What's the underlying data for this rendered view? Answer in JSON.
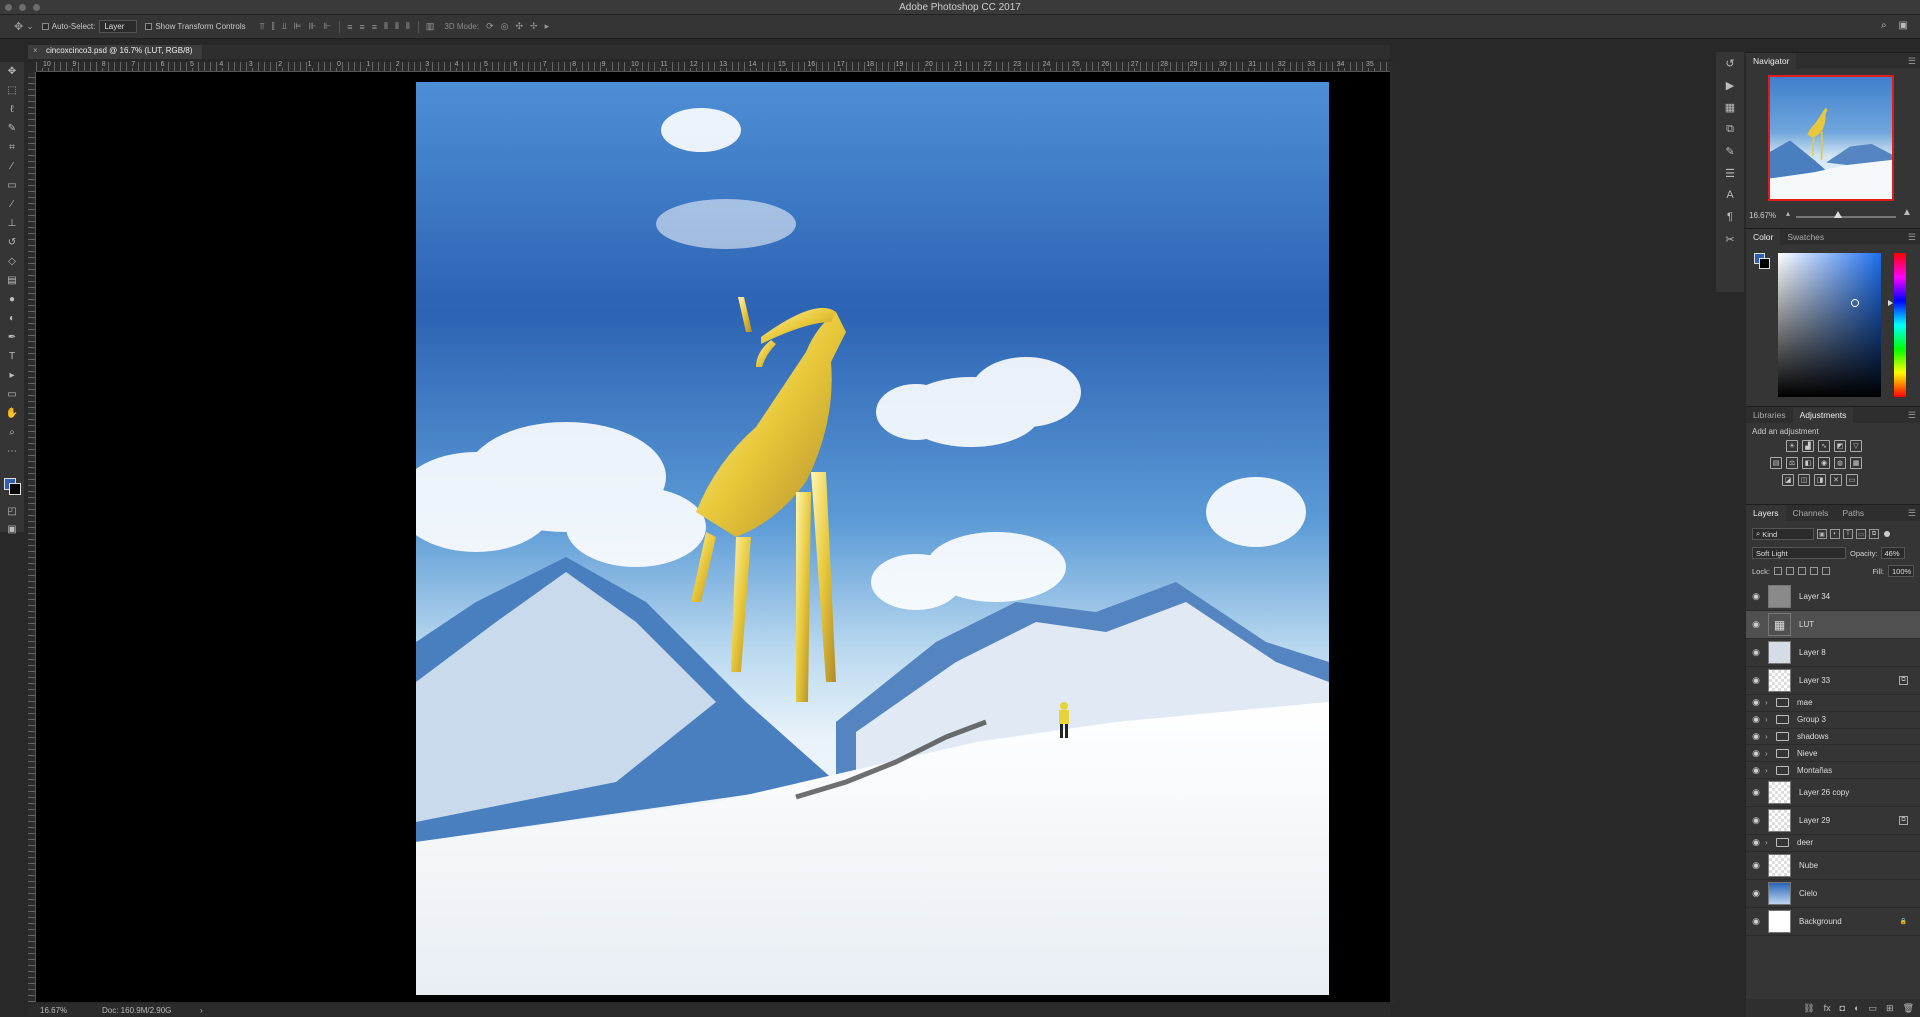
{
  "window": {
    "title": "Adobe Photoshop CC 2017"
  },
  "options_bar": {
    "auto_select_label": "Auto-Select:",
    "auto_select_value": "Layer",
    "transform_label": "Show Transform Controls",
    "mode_3d_label": "3D Mode:"
  },
  "document": {
    "tab_title": "cincoxcinco3.psd @ 16.7% (LUT, RGB/8)",
    "zoom": "16.67%",
    "doc_size": "Doc: 160.9M/2.90G"
  },
  "ruler_numbers": [
    "10",
    "9",
    "8",
    "7",
    "6",
    "5",
    "4",
    "3",
    "2",
    "1",
    "0",
    "1",
    "2",
    "3",
    "4",
    "5",
    "6",
    "7",
    "8",
    "9",
    "10",
    "11",
    "12",
    "13",
    "14",
    "15",
    "16",
    "17",
    "18",
    "19",
    "20",
    "21",
    "22",
    "23",
    "24",
    "25",
    "26",
    "27",
    "28",
    "29",
    "30",
    "31",
    "32",
    "33",
    "34",
    "35"
  ],
  "navigator": {
    "tab": "Navigator",
    "zoom": "16.67%"
  },
  "color_panel": {
    "tabs": [
      "Color",
      "Swatches"
    ],
    "foreground": "#2e5fb0",
    "background": "#000000"
  },
  "adjustments_panel": {
    "tabs": [
      "Libraries",
      "Adjustments"
    ],
    "hint": "Add an adjustment"
  },
  "layers_panel": {
    "tabs": [
      "Layers",
      "Channels",
      "Paths"
    ],
    "filter_kind": "Kind",
    "blend_mode": "Soft Light",
    "opacity_label": "Opacity:",
    "opacity_value": "46%",
    "lock_label": "Lock:",
    "fill_label": "Fill:",
    "fill_value": "100%",
    "layers": [
      {
        "name": "Layer 34",
        "type": "layer",
        "thumb": "gray",
        "selected": false,
        "badge": false
      },
      {
        "name": "LUT",
        "type": "adjustment",
        "thumb": "lut",
        "selected": true,
        "badge": false
      },
      {
        "name": "Layer 8",
        "type": "layer",
        "thumb": "blue",
        "selected": false,
        "badge": false
      },
      {
        "name": "Layer 33",
        "type": "layer",
        "thumb": "checker",
        "selected": false,
        "badge": true
      },
      {
        "name": "mae",
        "type": "group"
      },
      {
        "name": "Group 3",
        "type": "group"
      },
      {
        "name": "shadows",
        "type": "group"
      },
      {
        "name": "Nieve",
        "type": "group"
      },
      {
        "name": "Montañas",
        "type": "group"
      },
      {
        "name": "Layer 26 copy",
        "type": "layer",
        "thumb": "checker",
        "selected": false,
        "badge": false
      },
      {
        "name": "Layer 29",
        "type": "layer",
        "thumb": "checker",
        "selected": false,
        "badge": true
      },
      {
        "name": "deer",
        "type": "group"
      },
      {
        "name": "Nube",
        "type": "layer",
        "thumb": "checker",
        "selected": false,
        "badge": false
      },
      {
        "name": "Cielo",
        "type": "layer",
        "thumb": "sky",
        "selected": false,
        "badge": false
      },
      {
        "name": "Background",
        "type": "layer",
        "thumb": "white",
        "selected": false,
        "badge": false,
        "locked": true
      }
    ]
  }
}
